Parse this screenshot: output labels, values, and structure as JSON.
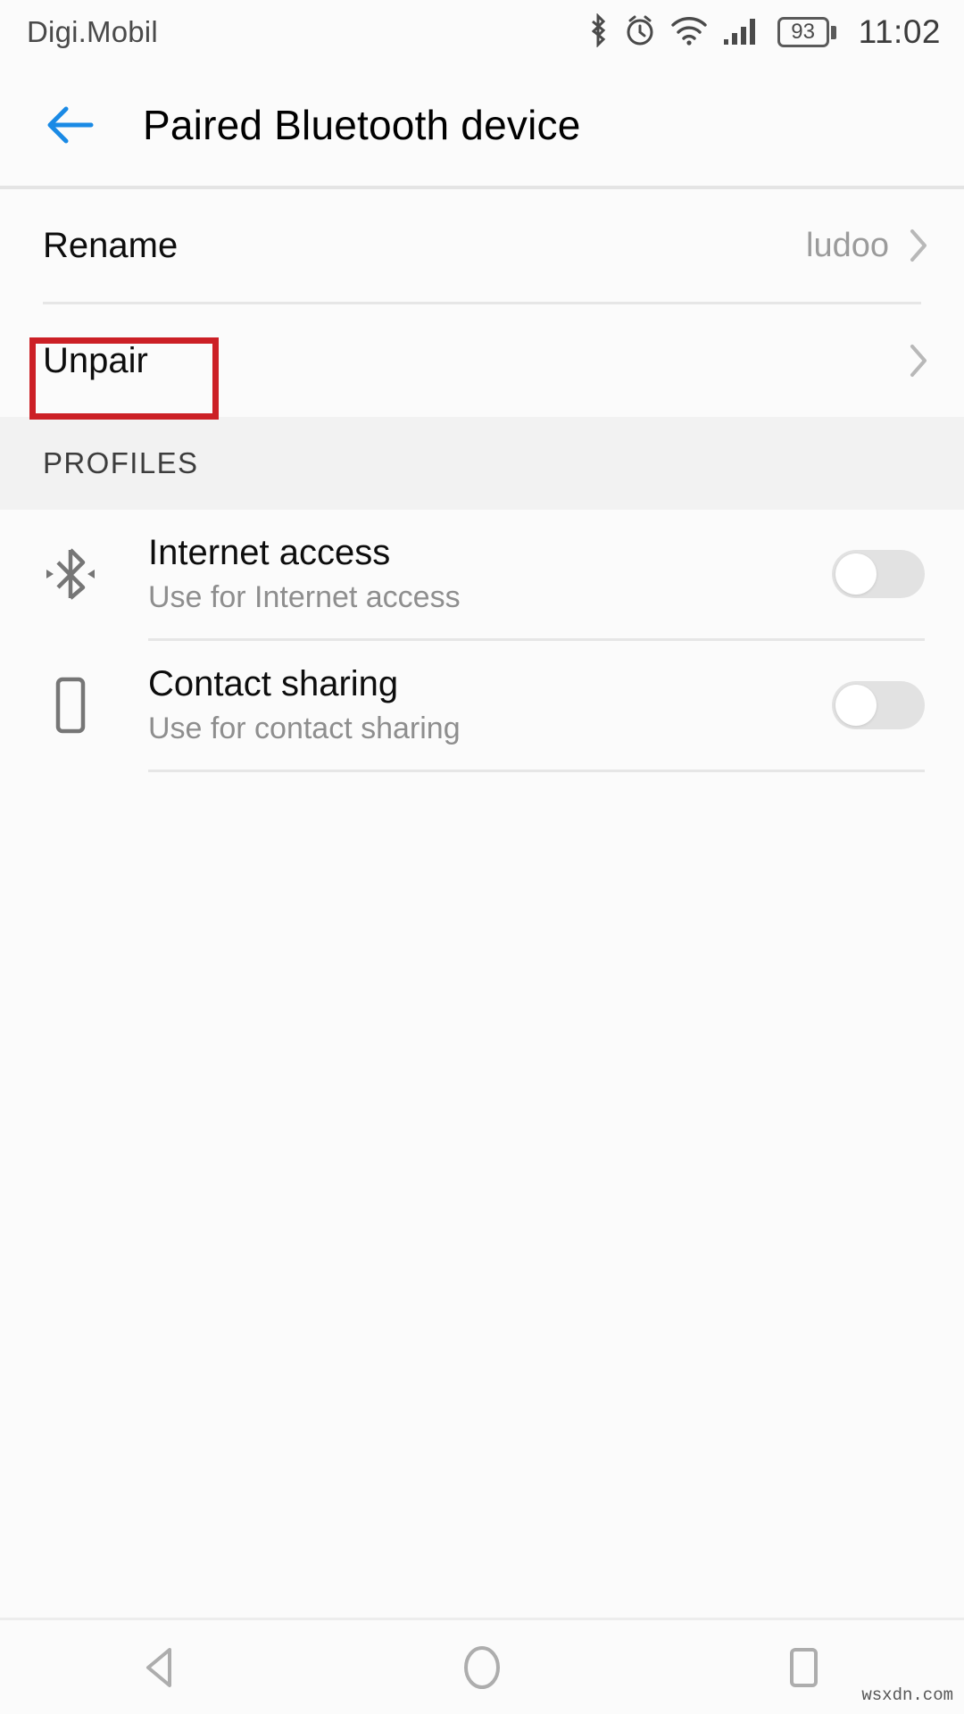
{
  "status_bar": {
    "carrier": "Digi.Mobil",
    "battery_percent": "93",
    "time": "11:02",
    "icons": [
      "bluetooth-icon",
      "alarm-icon",
      "wifi-icon",
      "cellular-signal-icon",
      "battery-icon"
    ]
  },
  "header": {
    "title": "Paired Bluetooth device",
    "back_icon": "arrow-left-icon",
    "back_color": "#1a8ae5"
  },
  "settings_rows": [
    {
      "label": "Rename",
      "value": "ludoo",
      "chevron": "chevron-right-icon"
    },
    {
      "label": "Unpair",
      "value": "",
      "chevron": "chevron-right-icon"
    }
  ],
  "section": {
    "title": "PROFILES"
  },
  "profiles": [
    {
      "icon": "bluetooth-tethering-icon",
      "title": "Internet access",
      "subtitle": "Use for Internet access",
      "toggle_state": "off"
    },
    {
      "icon": "phone-icon",
      "title": "Contact sharing",
      "subtitle": "Use for contact sharing",
      "toggle_state": "off"
    }
  ],
  "annotation": {
    "color": "#cc2026",
    "target": "Unpair"
  },
  "nav_bar": {
    "back_icon": "triangle-back-icon",
    "home_icon": "circle-home-icon",
    "recents_icon": "square-recents-icon"
  },
  "watermark": "wsxdn.com"
}
